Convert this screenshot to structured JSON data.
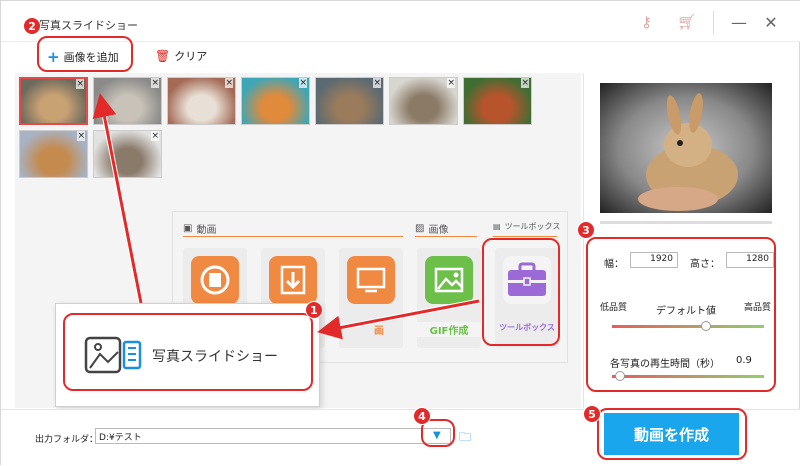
{
  "window": {
    "title": "写真スライドショー",
    "minimize": "—",
    "close": "✕"
  },
  "toolbar": {
    "add_label": "画像を追加",
    "clear_label": "クリア"
  },
  "thumbnails": [
    {
      "name": "rabbit",
      "selected": true
    },
    {
      "name": "cats-pile",
      "selected": false
    },
    {
      "name": "cats-bed",
      "selected": false
    },
    {
      "name": "cat-orange",
      "selected": false
    },
    {
      "name": "dog-sleeping",
      "selected": false
    },
    {
      "name": "hedgehog",
      "selected": false
    },
    {
      "name": "red-panda",
      "selected": false
    },
    {
      "name": "puppy",
      "selected": false
    },
    {
      "name": "kittens-basket",
      "selected": false
    }
  ],
  "settings": {
    "width_label": "幅：",
    "width_value": "1920",
    "height_label": "高さ：",
    "height_value": "1280",
    "low_quality": "低品質",
    "default_value": "デフォルト値",
    "high_quality": "高品質",
    "quality_level": 0.62,
    "duration_label": "各写真の再生時間（秒）",
    "duration_value": "0.9",
    "duration_level": 0.05
  },
  "output": {
    "label": "出力フォルダ：",
    "path": "D:¥テスト"
  },
  "make_button": "動画を作成",
  "panel": {
    "section_video": "動画",
    "section_image": "画像",
    "section_toolbox": "ツールボックス",
    "tiles": [
      {
        "label": "",
        "icon": "film-reel-icon",
        "color": "#f08a43"
      },
      {
        "label": "",
        "icon": "download-icon",
        "color": "#f08a43"
      },
      {
        "label": "画",
        "icon": "screen-record-icon",
        "color": "#f08a43"
      },
      {
        "label": "GIF作成",
        "icon": "gif-image-icon",
        "color": "#6cc04a"
      },
      {
        "label": "ツールボックス",
        "icon": "toolbox-icon",
        "color": "#9b6ad6"
      }
    ]
  },
  "popup": {
    "label": "写真スライドショー"
  },
  "badges": {
    "b1": "1",
    "b2": "2",
    "b3": "3",
    "b4": "4",
    "b5": "5"
  },
  "colors": {
    "accent": "#19a6ec",
    "annotation": "#e32a2a",
    "video_orange": "#f08a43",
    "gif_green": "#6cc04a",
    "toolbox_purple": "#9b6ad6"
  }
}
